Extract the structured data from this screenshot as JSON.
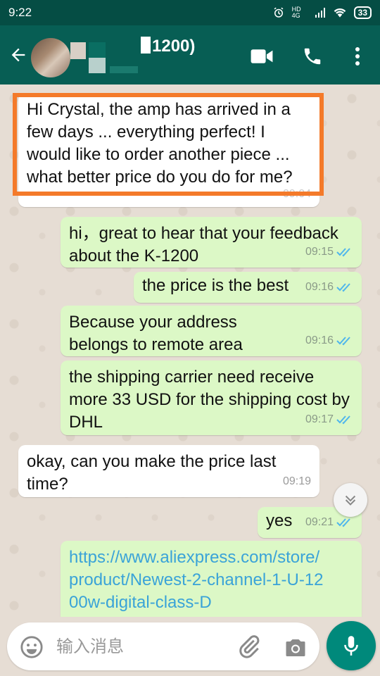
{
  "status_bar": {
    "time": "9:22",
    "signal_label": "HD 4G",
    "battery": "33"
  },
  "header": {
    "contact_name": "1200)"
  },
  "messages": [
    {
      "dir": "in",
      "text": "Hi Crystal, the amp has arrived in a few days ... everything perfect! I would like to order another piece ... what better price do you do for me?",
      "time": "09:04"
    },
    {
      "dir": "out",
      "text": "hi，great to hear that your feedback about the K-1200",
      "time": "09:15"
    },
    {
      "dir": "out",
      "text": "the price is the best",
      "time": "09:16"
    },
    {
      "dir": "out",
      "text": "Because your address belongs to remote area",
      "time": "09:16"
    },
    {
      "dir": "out",
      "text": "the shipping carrier need receive more 33 USD for the shipping cost by DHL",
      "time": "09:17"
    },
    {
      "dir": "in",
      "text": "okay, can you make the price last time?",
      "time": "09:19"
    },
    {
      "dir": "out",
      "text": "yes",
      "time": "09:21"
    },
    {
      "dir": "out",
      "text": "https://www.aliexpress.com/store/product/Newest-2-channel-1-U-1200w-digital-class-D",
      "time": ""
    }
  ],
  "composer": {
    "placeholder": "输入消息"
  },
  "colors": {
    "header": "#075e54",
    "status_bar": "#054d44",
    "outgoing": "#dcf8c6",
    "incoming": "#ffffff",
    "tick": "#4fb6ec",
    "highlight": "#f47a2a",
    "fab": "#00897b"
  },
  "icons": [
    "back-arrow-icon",
    "video-call-icon",
    "phone-icon",
    "more-vert-icon",
    "alarm-icon",
    "wifi-icon",
    "double-chevron-down-icon",
    "emoji-icon",
    "paperclip-icon",
    "camera-icon",
    "microphone-icon",
    "double-tick-icon"
  ]
}
